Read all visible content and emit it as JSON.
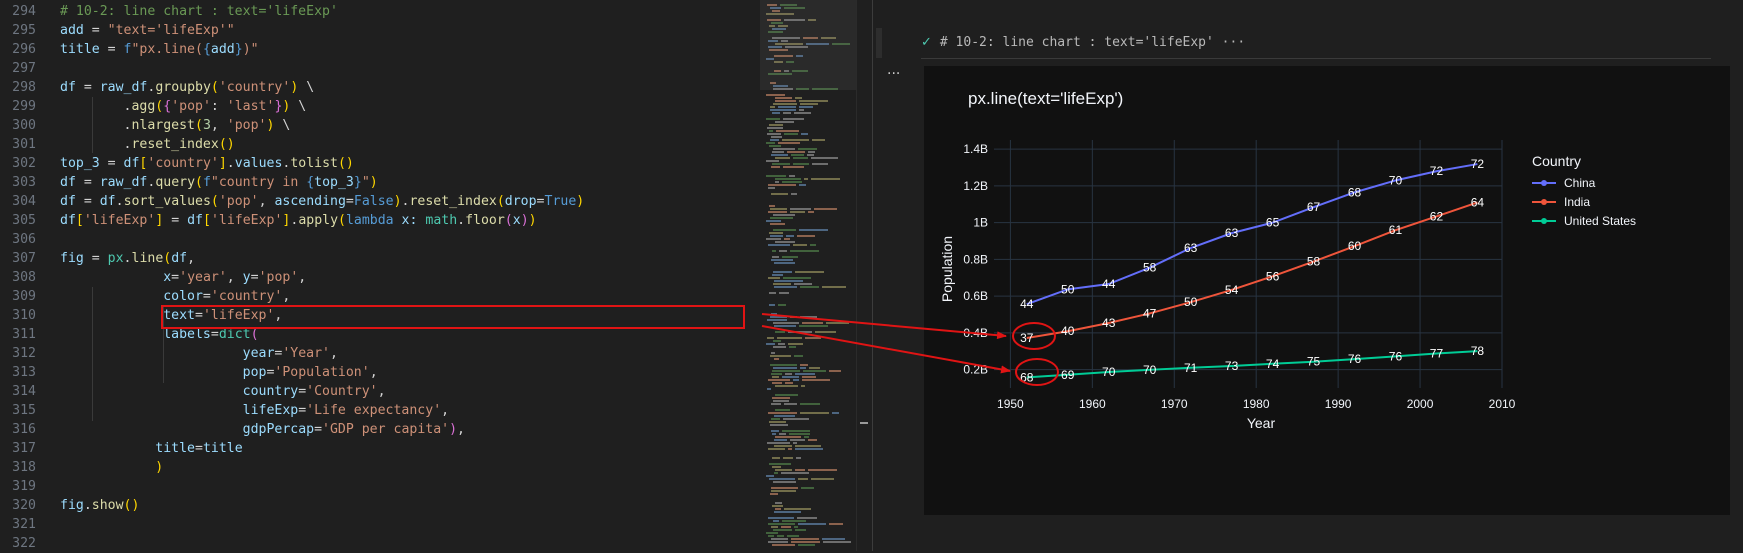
{
  "editor": {
    "lines": [
      {
        "n": "294",
        "tokens": [
          [
            "# 10-2: line chart : text='lifeExp'",
            "#6a9955"
          ]
        ]
      },
      {
        "n": "295",
        "tokens": [
          [
            "add",
            "#9cdcfe"
          ],
          [
            " = ",
            "#d4d4d4"
          ],
          [
            "\"text='lifeExp'\"",
            "#ce9178"
          ]
        ]
      },
      {
        "n": "296",
        "tokens": [
          [
            "title",
            "#9cdcfe"
          ],
          [
            " = ",
            "#d4d4d4"
          ],
          [
            "f",
            "#569cd6"
          ],
          [
            "\"px.line(",
            "#ce9178"
          ],
          [
            "{",
            "#569cd6"
          ],
          [
            "add",
            "#9cdcfe"
          ],
          [
            "}",
            "#569cd6"
          ],
          [
            ")\"",
            "#ce9178"
          ]
        ]
      },
      {
        "n": "297",
        "tokens": []
      },
      {
        "n": "298",
        "tokens": [
          [
            "df",
            "#9cdcfe"
          ],
          [
            " = ",
            "#d4d4d4"
          ],
          [
            "raw_df",
            "#9cdcfe"
          ],
          [
            ".",
            "#d4d4d4"
          ],
          [
            "groupby",
            "#dcdcaa"
          ],
          [
            "(",
            "#ffd700"
          ],
          [
            "'country'",
            "#ce9178"
          ],
          [
            ")",
            "#ffd700"
          ],
          [
            " \\",
            "#d4d4d4"
          ]
        ]
      },
      {
        "n": "299",
        "tokens": [
          [
            "        .",
            "#d4d4d4"
          ],
          [
            "agg",
            "#dcdcaa"
          ],
          [
            "(",
            "#ffd700"
          ],
          [
            "{",
            "#da70d6"
          ],
          [
            "'pop'",
            "#ce9178"
          ],
          [
            ": ",
            "#d4d4d4"
          ],
          [
            "'last'",
            "#ce9178"
          ],
          [
            "}",
            "#da70d6"
          ],
          [
            ")",
            "#ffd700"
          ],
          [
            " \\",
            "#d4d4d4"
          ]
        ]
      },
      {
        "n": "300",
        "tokens": [
          [
            "        .",
            "#d4d4d4"
          ],
          [
            "nlargest",
            "#dcdcaa"
          ],
          [
            "(",
            "#ffd700"
          ],
          [
            "3",
            "#b5cea8"
          ],
          [
            ", ",
            "#d4d4d4"
          ],
          [
            "'pop'",
            "#ce9178"
          ],
          [
            ")",
            "#ffd700"
          ],
          [
            " \\",
            "#d4d4d4"
          ]
        ]
      },
      {
        "n": "301",
        "tokens": [
          [
            "        .",
            "#d4d4d4"
          ],
          [
            "reset_index",
            "#dcdcaa"
          ],
          [
            "()",
            "#ffd700"
          ]
        ]
      },
      {
        "n": "302",
        "tokens": [
          [
            "top_3",
            "#9cdcfe"
          ],
          [
            " = ",
            "#d4d4d4"
          ],
          [
            "df",
            "#9cdcfe"
          ],
          [
            "[",
            "#ffd700"
          ],
          [
            "'country'",
            "#ce9178"
          ],
          [
            "]",
            "#ffd700"
          ],
          [
            ".",
            "#d4d4d4"
          ],
          [
            "values",
            "#9cdcfe"
          ],
          [
            ".",
            "#d4d4d4"
          ],
          [
            "tolist",
            "#dcdcaa"
          ],
          [
            "()",
            "#ffd700"
          ]
        ]
      },
      {
        "n": "303",
        "tokens": [
          [
            "df",
            "#9cdcfe"
          ],
          [
            " = ",
            "#d4d4d4"
          ],
          [
            "raw_df",
            "#9cdcfe"
          ],
          [
            ".",
            "#d4d4d4"
          ],
          [
            "query",
            "#dcdcaa"
          ],
          [
            "(",
            "#ffd700"
          ],
          [
            "f",
            "#569cd6"
          ],
          [
            "\"country in ",
            "#ce9178"
          ],
          [
            "{",
            "#569cd6"
          ],
          [
            "top_3",
            "#9cdcfe"
          ],
          [
            "}",
            "#569cd6"
          ],
          [
            "\"",
            "#ce9178"
          ],
          [
            ")",
            "#ffd700"
          ]
        ]
      },
      {
        "n": "304",
        "tokens": [
          [
            "df",
            "#9cdcfe"
          ],
          [
            " = ",
            "#d4d4d4"
          ],
          [
            "df",
            "#9cdcfe"
          ],
          [
            ".",
            "#d4d4d4"
          ],
          [
            "sort_values",
            "#dcdcaa"
          ],
          [
            "(",
            "#ffd700"
          ],
          [
            "'pop'",
            "#ce9178"
          ],
          [
            ", ",
            "#d4d4d4"
          ],
          [
            "ascending",
            "#9cdcfe"
          ],
          [
            "=",
            "#d4d4d4"
          ],
          [
            "False",
            "#569cd6"
          ],
          [
            ")",
            "#ffd700"
          ],
          [
            ".",
            "#d4d4d4"
          ],
          [
            "reset_index",
            "#dcdcaa"
          ],
          [
            "(",
            "#ffd700"
          ],
          [
            "drop",
            "#9cdcfe"
          ],
          [
            "=",
            "#d4d4d4"
          ],
          [
            "True",
            "#569cd6"
          ],
          [
            ")",
            "#ffd700"
          ]
        ]
      },
      {
        "n": "305",
        "tokens": [
          [
            "df",
            "#9cdcfe"
          ],
          [
            "[",
            "#ffd700"
          ],
          [
            "'lifeExp'",
            "#ce9178"
          ],
          [
            "]",
            "#ffd700"
          ],
          [
            " = ",
            "#d4d4d4"
          ],
          [
            "df",
            "#9cdcfe"
          ],
          [
            "[",
            "#ffd700"
          ],
          [
            "'lifeExp'",
            "#ce9178"
          ],
          [
            "]",
            "#ffd700"
          ],
          [
            ".",
            "#d4d4d4"
          ],
          [
            "apply",
            "#dcdcaa"
          ],
          [
            "(",
            "#ffd700"
          ],
          [
            "lambda",
            "#569cd6"
          ],
          [
            " x: ",
            "#9cdcfe"
          ],
          [
            "math",
            "#4ec9b0"
          ],
          [
            ".",
            "#d4d4d4"
          ],
          [
            "floor",
            "#dcdcaa"
          ],
          [
            "(",
            "#da70d6"
          ],
          [
            "x",
            "#9cdcfe"
          ],
          [
            ")",
            "#da70d6"
          ],
          [
            ")",
            "#ffd700"
          ]
        ]
      },
      {
        "n": "306",
        "tokens": []
      },
      {
        "n": "307",
        "tokens": [
          [
            "fig",
            "#9cdcfe"
          ],
          [
            " = ",
            "#d4d4d4"
          ],
          [
            "px",
            "#4ec9b0"
          ],
          [
            ".",
            "#d4d4d4"
          ],
          [
            "line",
            "#dcdcaa"
          ],
          [
            "(",
            "#ffd700"
          ],
          [
            "df",
            "#9cdcfe"
          ],
          [
            ",",
            "#d4d4d4"
          ]
        ]
      },
      {
        "n": "308",
        "tokens": [
          [
            "             ",
            "#d4d4d4"
          ],
          [
            "x",
            "#9cdcfe"
          ],
          [
            "=",
            "#d4d4d4"
          ],
          [
            "'year'",
            "#ce9178"
          ],
          [
            ", ",
            "#d4d4d4"
          ],
          [
            "y",
            "#9cdcfe"
          ],
          [
            "=",
            "#d4d4d4"
          ],
          [
            "'pop'",
            "#ce9178"
          ],
          [
            ",",
            "#d4d4d4"
          ]
        ]
      },
      {
        "n": "309",
        "tokens": [
          [
            "             ",
            "#d4d4d4"
          ],
          [
            "color",
            "#9cdcfe"
          ],
          [
            "=",
            "#d4d4d4"
          ],
          [
            "'country'",
            "#ce9178"
          ],
          [
            ",",
            "#d4d4d4"
          ]
        ]
      },
      {
        "n": "310",
        "tokens": [
          [
            "             ",
            "#d4d4d4"
          ],
          [
            "text",
            "#9cdcfe"
          ],
          [
            "=",
            "#d4d4d4"
          ],
          [
            "'lifeExp'",
            "#ce9178"
          ],
          [
            ",",
            "#d4d4d4"
          ]
        ]
      },
      {
        "n": "311",
        "tokens": [
          [
            "             ",
            "#d4d4d4"
          ],
          [
            "labels",
            "#9cdcfe"
          ],
          [
            "=",
            "#d4d4d4"
          ],
          [
            "dict",
            "#4ec9b0"
          ],
          [
            "(",
            "#da70d6"
          ]
        ]
      },
      {
        "n": "312",
        "tokens": [
          [
            "                       ",
            "#d4d4d4"
          ],
          [
            "year",
            "#9cdcfe"
          ],
          [
            "=",
            "#d4d4d4"
          ],
          [
            "'Year'",
            "#ce9178"
          ],
          [
            ",",
            "#d4d4d4"
          ]
        ]
      },
      {
        "n": "313",
        "tokens": [
          [
            "                       ",
            "#d4d4d4"
          ],
          [
            "pop",
            "#9cdcfe"
          ],
          [
            "=",
            "#d4d4d4"
          ],
          [
            "'Population'",
            "#ce9178"
          ],
          [
            ",",
            "#d4d4d4"
          ]
        ]
      },
      {
        "n": "314",
        "tokens": [
          [
            "                       ",
            "#d4d4d4"
          ],
          [
            "country",
            "#9cdcfe"
          ],
          [
            "=",
            "#d4d4d4"
          ],
          [
            "'Country'",
            "#ce9178"
          ],
          [
            ",",
            "#d4d4d4"
          ]
        ]
      },
      {
        "n": "315",
        "tokens": [
          [
            "                       ",
            "#d4d4d4"
          ],
          [
            "lifeExp",
            "#9cdcfe"
          ],
          [
            "=",
            "#d4d4d4"
          ],
          [
            "'Life expectancy'",
            "#ce9178"
          ],
          [
            ",",
            "#d4d4d4"
          ]
        ]
      },
      {
        "n": "316",
        "tokens": [
          [
            "                       ",
            "#d4d4d4"
          ],
          [
            "gdpPercap",
            "#9cdcfe"
          ],
          [
            "=",
            "#d4d4d4"
          ],
          [
            "'GDP per capita'",
            "#ce9178"
          ],
          [
            ")",
            "#da70d6"
          ],
          [
            ",",
            "#d4d4d4"
          ]
        ]
      },
      {
        "n": "317",
        "tokens": [
          [
            "            ",
            "#d4d4d4"
          ],
          [
            "title",
            "#9cdcfe"
          ],
          [
            "=",
            "#d4d4d4"
          ],
          [
            "title",
            "#9cdcfe"
          ]
        ]
      },
      {
        "n": "318",
        "tokens": [
          [
            "            ",
            "#d4d4d4"
          ],
          [
            ")",
            "#ffd700"
          ]
        ]
      },
      {
        "n": "319",
        "tokens": []
      },
      {
        "n": "320",
        "tokens": [
          [
            "fig",
            "#9cdcfe"
          ],
          [
            ".",
            "#d4d4d4"
          ],
          [
            "show",
            "#dcdcaa"
          ],
          [
            "()",
            "#ffd700"
          ]
        ]
      },
      {
        "n": "321",
        "tokens": []
      },
      {
        "n": "322",
        "tokens": []
      }
    ]
  },
  "output": {
    "cell_header": "# 10-2: line chart : text='lifeExp'",
    "more_label": "···",
    "dots_label": "...",
    "check_icon": "check-icon"
  },
  "colors": {
    "annotation_red": "#e01414",
    "plot_bg": "#111111",
    "grid": "#283442"
  },
  "chart_data": {
    "type": "line",
    "title": "px.line(text='lifeExp')",
    "xlabel": "Year",
    "ylabel": "Population",
    "xlim": [
      1948,
      2010
    ],
    "ylim": [
      0.1,
      1.45
    ],
    "x_ticks": [
      1950,
      1960,
      1970,
      1980,
      1990,
      2000,
      2010
    ],
    "x_tick_labels": [
      "1950",
      "1960",
      "1970",
      "1980",
      "1990",
      "2000",
      "2010"
    ],
    "y_ticks": [
      0.2,
      0.4,
      0.6,
      0.8,
      1.0,
      1.2,
      1.4
    ],
    "y_tick_labels": [
      "0.2B",
      "0.4B",
      "0.6B",
      "0.8B",
      "1B",
      "1.2B",
      "1.4B"
    ],
    "legend_title": "Country",
    "legend_position": "right",
    "x": [
      1952,
      1957,
      1962,
      1967,
      1972,
      1977,
      1982,
      1987,
      1992,
      1997,
      2002,
      2007
    ],
    "series": [
      {
        "name": "China",
        "color": "#636efa",
        "values": [
          0.556,
          0.637,
          0.666,
          0.755,
          0.862,
          0.943,
          1.0,
          1.084,
          1.165,
          1.23,
          1.28,
          1.319
        ],
        "labels": [
          "44",
          "50",
          "44",
          "58",
          "63",
          "63",
          "65",
          "67",
          "68",
          "70",
          "72",
          "72"
        ]
      },
      {
        "name": "India",
        "color": "#ef553b",
        "values": [
          0.372,
          0.409,
          0.454,
          0.506,
          0.567,
          0.634,
          0.708,
          0.788,
          0.872,
          0.959,
          1.034,
          1.11
        ],
        "labels": [
          "37",
          "40",
          "43",
          "47",
          "50",
          "54",
          "56",
          "58",
          "60",
          "61",
          "62",
          "64"
        ]
      },
      {
        "name": "United States",
        "color": "#00cc96",
        "values": [
          0.158,
          0.172,
          0.187,
          0.199,
          0.21,
          0.22,
          0.232,
          0.243,
          0.257,
          0.272,
          0.288,
          0.301
        ],
        "labels": [
          "68",
          "69",
          "70",
          "70",
          "71",
          "73",
          "74",
          "75",
          "76",
          "76",
          "77",
          "78"
        ]
      }
    ]
  }
}
